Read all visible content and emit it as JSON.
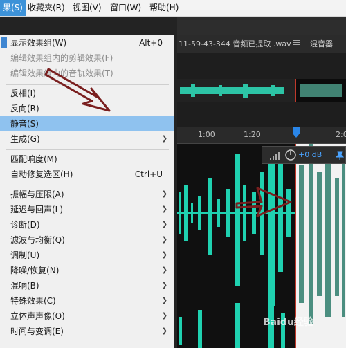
{
  "menubar": {
    "items": [
      {
        "label": "果(S)",
        "active": true
      },
      {
        "label": "收藏夹(R)"
      },
      {
        "label": "视图(V)"
      },
      {
        "label": "窗口(W)"
      },
      {
        "label": "帮助(H)"
      }
    ]
  },
  "editor": {
    "file_tab": "11-59-43-344 音频已提取 .wav",
    "mixer_tab": "混音器",
    "ruler_labels": [
      "1:00",
      "1:20",
      "2:0"
    ],
    "hud_db": "+0 dB"
  },
  "menu": {
    "items": [
      {
        "label": "显示效果组(W)",
        "shortcut": "Alt+0",
        "checked": true
      },
      {
        "label": "编辑效果组内的剪辑效果(F)",
        "disabled": true
      },
      {
        "label": "编辑效果组内的音轨效果(T)",
        "disabled": true
      },
      {
        "label": "反相(I)"
      },
      {
        "label": "反向(R)"
      },
      {
        "label": "静音(S)",
        "highlight": true
      },
      {
        "label": "生成(G)",
        "submenu": true
      },
      {
        "label": "匹配响度(M)"
      },
      {
        "label": "自动修复选区(H)",
        "shortcut": "Ctrl+U"
      },
      {
        "label": "振幅与压限(A)",
        "submenu": true
      },
      {
        "label": "延迟与回声(L)",
        "submenu": true
      },
      {
        "label": "诊断(D)",
        "submenu": true
      },
      {
        "label": "滤波与均衡(Q)",
        "submenu": true
      },
      {
        "label": "调制(U)",
        "submenu": true
      },
      {
        "label": "降噪/恢复(N)",
        "submenu": true
      },
      {
        "label": "混响(B)",
        "submenu": true
      },
      {
        "label": "特殊效果(C)",
        "submenu": true
      },
      {
        "label": "立体声声像(O)",
        "submenu": true
      },
      {
        "label": "时间与变调(E)",
        "submenu": true
      }
    ]
  },
  "watermark": "Baidu经验",
  "colors": {
    "menu_highlight": "#8fc2ef",
    "menubar_active": "#3d92d8",
    "waveform": "#1fd1b0",
    "annotation_arrow": "#7a1f1f",
    "selection_border": "#c0392b"
  }
}
